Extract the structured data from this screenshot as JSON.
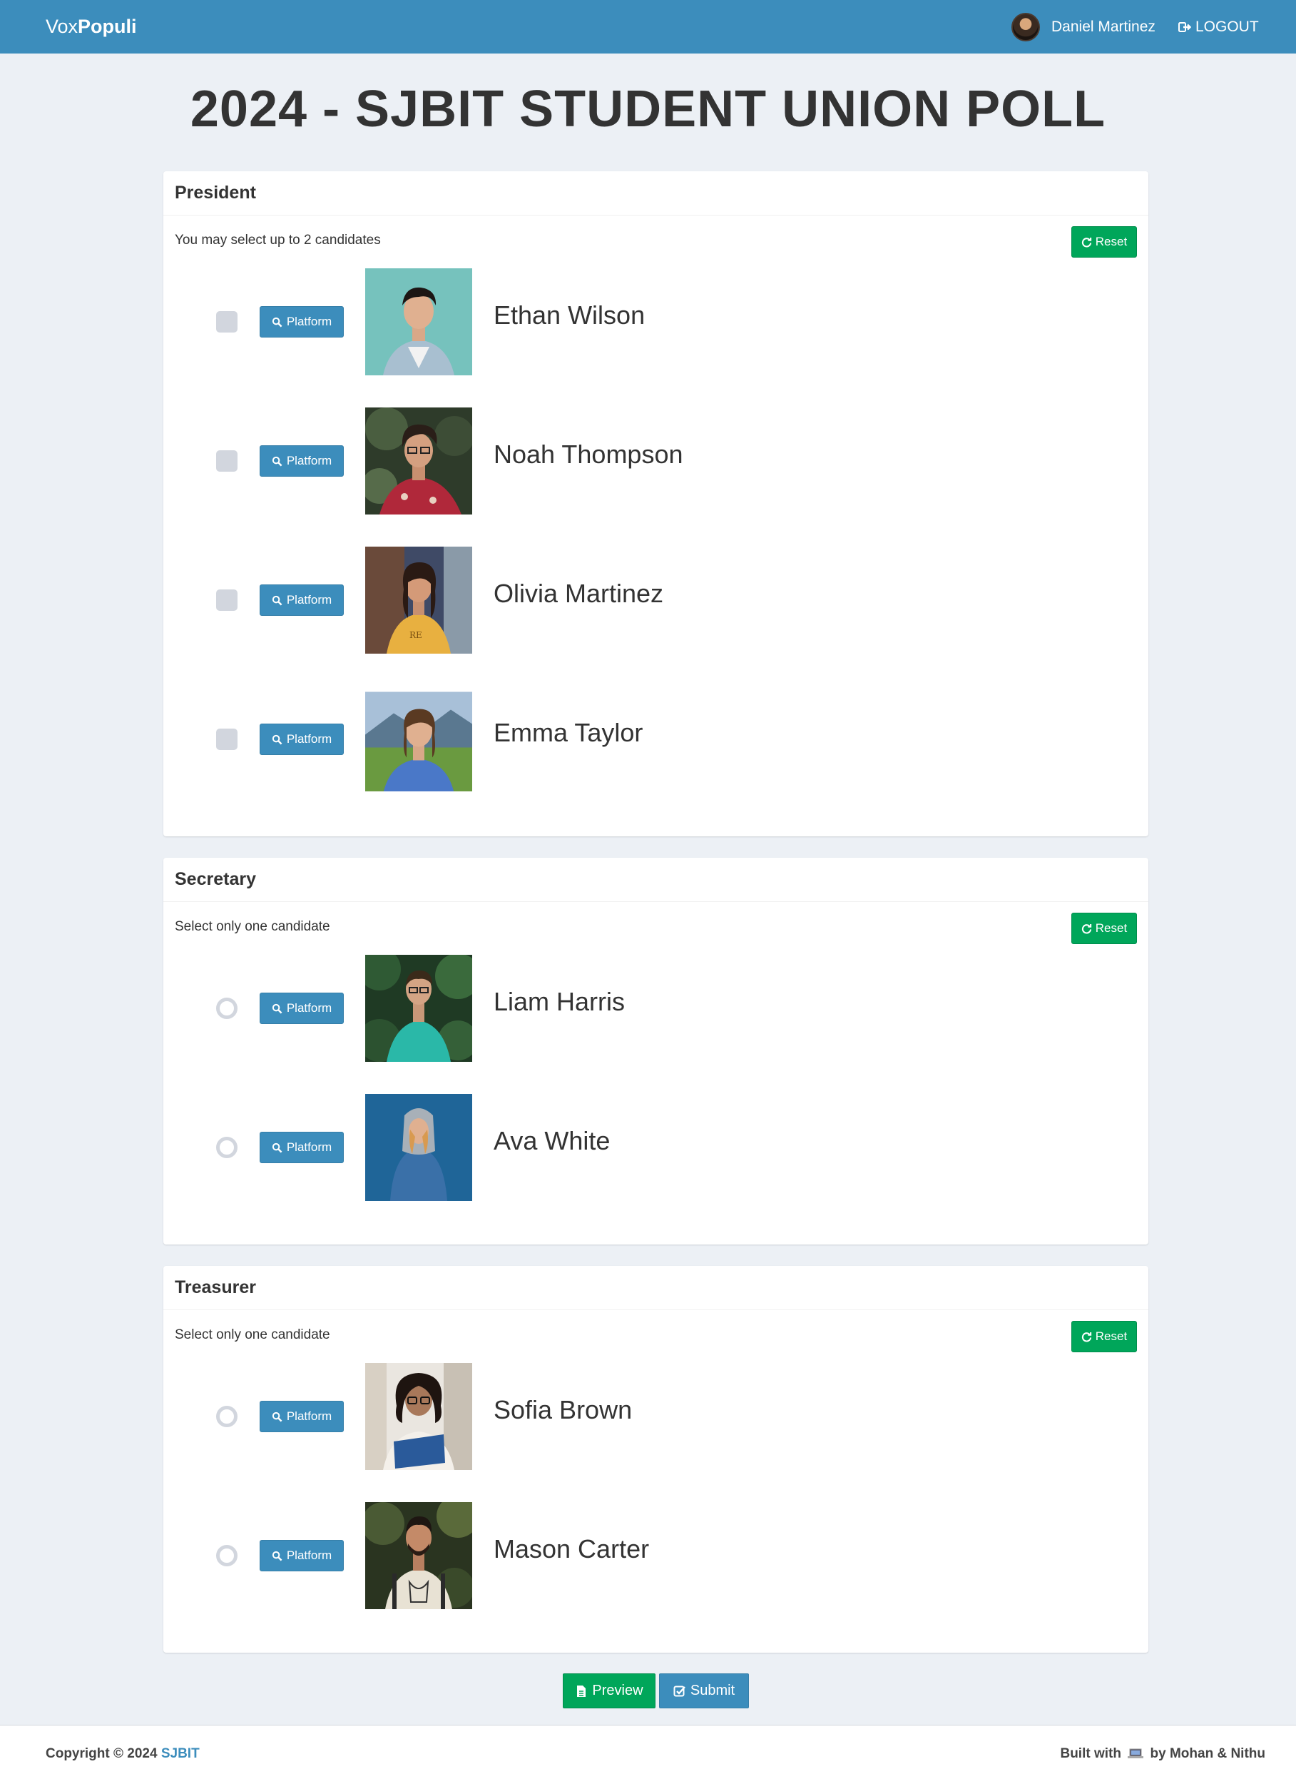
{
  "navbar": {
    "brand_prefix": "Vox",
    "brand_bold": "Populi",
    "user_name": "Daniel Martinez",
    "logout_label": "LOGOUT"
  },
  "page_title": "2024 - SJBIT STUDENT UNION POLL",
  "positions": [
    {
      "title": "President",
      "instruction": "You may select up to 2 candidates",
      "reset_label": "Reset",
      "input_type": "checkbox",
      "candidates": [
        {
          "name": "Ethan Wilson",
          "platform_label": "Platform"
        },
        {
          "name": "Noah Thompson",
          "platform_label": "Platform"
        },
        {
          "name": "Olivia Martinez",
          "platform_label": "Platform"
        },
        {
          "name": "Emma Taylor",
          "platform_label": "Platform"
        }
      ]
    },
    {
      "title": "Secretary",
      "instruction": "Select only one candidate",
      "reset_label": "Reset",
      "input_type": "radio",
      "candidates": [
        {
          "name": "Liam Harris",
          "platform_label": "Platform"
        },
        {
          "name": "Ava White",
          "platform_label": "Platform"
        }
      ]
    },
    {
      "title": "Treasurer",
      "instruction": "Select only one candidate",
      "reset_label": "Reset",
      "input_type": "radio",
      "candidates": [
        {
          "name": "Sofia Brown",
          "platform_label": "Platform"
        },
        {
          "name": "Mason Carter",
          "platform_label": "Platform"
        }
      ]
    }
  ],
  "actions": {
    "preview_label": "Preview",
    "submit_label": "Submit"
  },
  "footer": {
    "copyright_prefix": "Copyright © 2024",
    "copyright_link": "SJBIT",
    "built_prefix": "Built with",
    "built_suffix": "by Mohan & Nithu"
  },
  "colors": {
    "navbar": "#3c8dbc",
    "success": "#00a65a",
    "primary": "#3c8dbc",
    "background": "#ecf0f5"
  }
}
